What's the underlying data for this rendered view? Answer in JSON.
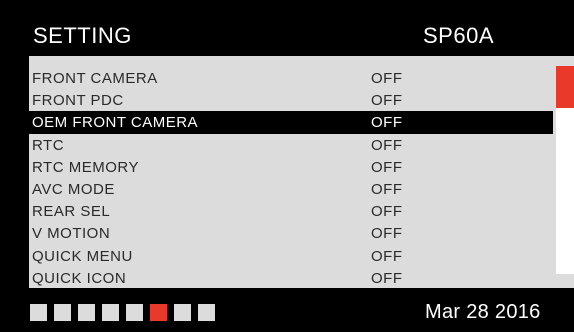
{
  "header": {
    "title": "SETTING",
    "model": "SP60A"
  },
  "menu": {
    "items": [
      {
        "label": "FRONT CAMERA",
        "value": "OFF",
        "selected": false
      },
      {
        "label": "FRONT PDC",
        "value": "OFF",
        "selected": false
      },
      {
        "label": "OEM FRONT CAMERA",
        "value": "OFF",
        "selected": true
      },
      {
        "label": "RTC",
        "value": "OFF",
        "selected": false
      },
      {
        "label": "RTC MEMORY",
        "value": "OFF",
        "selected": false
      },
      {
        "label": "AVC MODE",
        "value": "OFF",
        "selected": false
      },
      {
        "label": "REAR SEL",
        "value": "OFF",
        "selected": false
      },
      {
        "label": "V MOTION",
        "value": "OFF",
        "selected": false
      },
      {
        "label": "QUICK MENU",
        "value": "OFF",
        "selected": false
      },
      {
        "label": "QUICK ICON",
        "value": "OFF",
        "selected": false
      }
    ]
  },
  "pagination": {
    "total_pages": 8,
    "current_page": 6
  },
  "footer": {
    "date": "Mar 28 2016"
  },
  "colors": {
    "accent": "#e8392a",
    "panel": "#dcdcdc",
    "background": "#000000",
    "selected_row": "#000000"
  }
}
